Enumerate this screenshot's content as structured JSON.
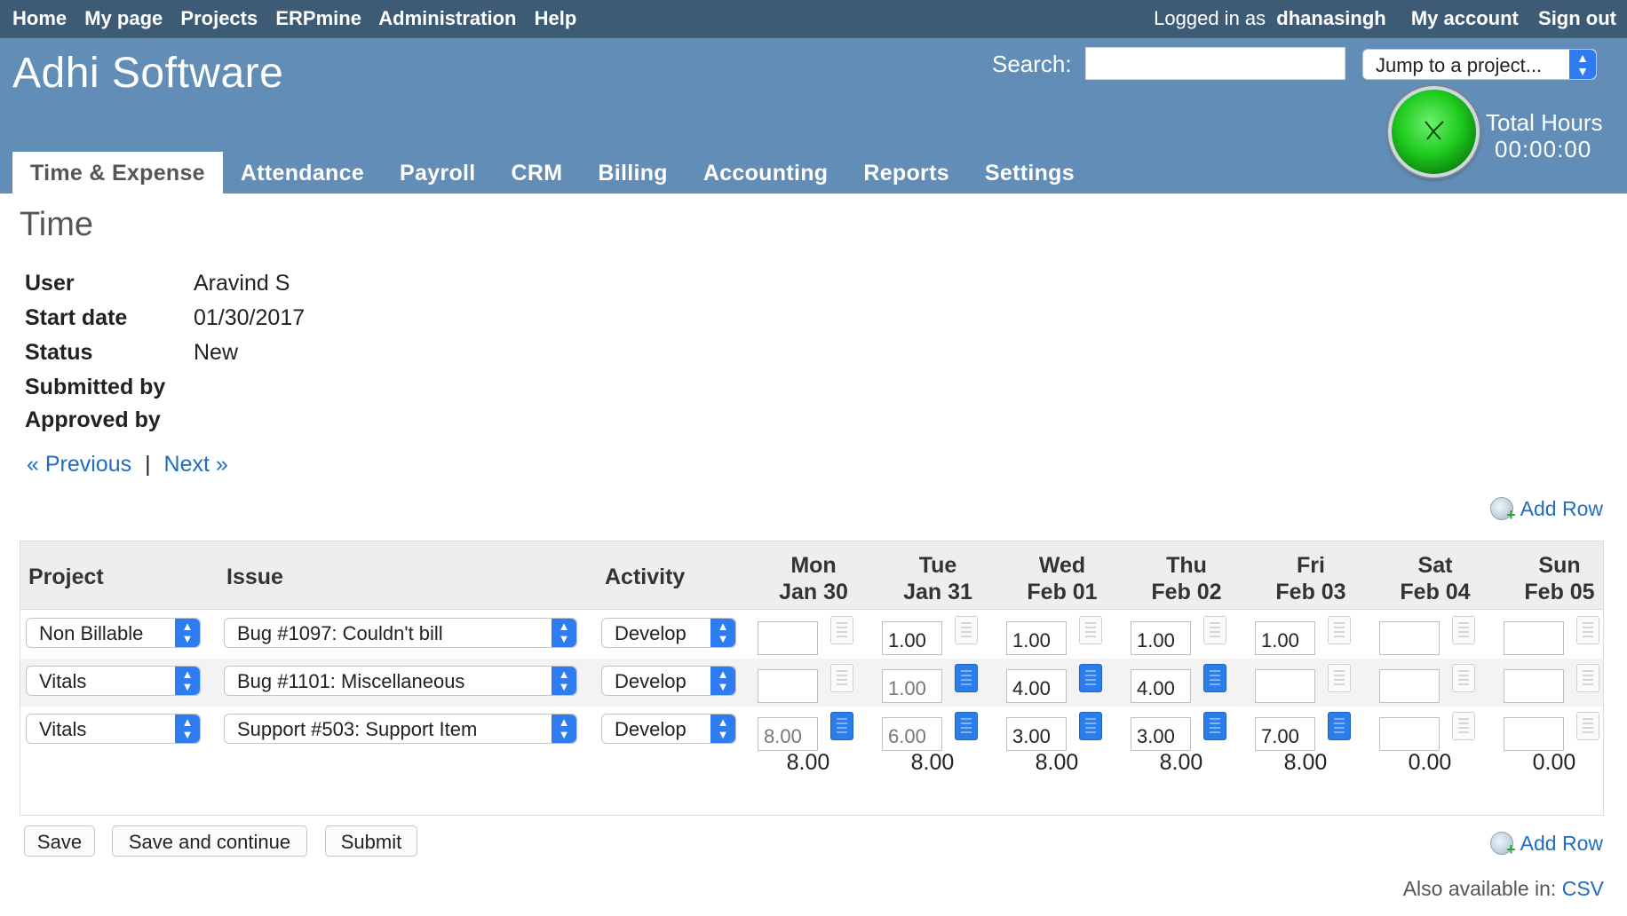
{
  "top_menu": {
    "items": [
      "Home",
      "My page",
      "Projects",
      "ERPmine",
      "Administration",
      "Help"
    ],
    "logged_in_prefix": "Logged in as",
    "user": "dhanasingh",
    "my_account": "My account",
    "sign_out": "Sign out"
  },
  "header": {
    "site_title": "Adhi Software",
    "search_label": "Search:",
    "search_value": "",
    "jump_to_project": "Jump to a project...",
    "total_hours_label": "Total Hours",
    "total_hours_value": "00:00:00"
  },
  "main_menu": [
    "Time & Expense",
    "Attendance",
    "Payroll",
    "CRM",
    "Billing",
    "Accounting",
    "Reports",
    "Settings"
  ],
  "page": {
    "title": "Time",
    "user_label": "User",
    "user_value": "Aravind S",
    "start_date_label": "Start date",
    "start_date_value": "01/30/2017",
    "status_label": "Status",
    "status_value": "New",
    "submitted_by_label": "Submitted by",
    "approved_by_label": "Approved by",
    "previous": "« Previous",
    "separator": "|",
    "next": "Next »",
    "add_row": "Add Row"
  },
  "table": {
    "headers": {
      "project": "Project",
      "issue": "Issue",
      "activity": "Activity"
    },
    "days": [
      {
        "dow": "Mon",
        "date": "Jan 30"
      },
      {
        "dow": "Tue",
        "date": "Jan 31"
      },
      {
        "dow": "Wed",
        "date": "Feb 01"
      },
      {
        "dow": "Thu",
        "date": "Feb 02"
      },
      {
        "dow": "Fri",
        "date": "Feb 03"
      },
      {
        "dow": "Sat",
        "date": "Feb 04"
      },
      {
        "dow": "Sun",
        "date": "Feb 05"
      }
    ],
    "rows": [
      {
        "project": "Non Billable",
        "issue": "Bug #1097: Couldn't bill",
        "activity": "Develop",
        "hours": [
          "",
          "1.00",
          "1.00",
          "1.00",
          "1.00",
          "",
          ""
        ]
      },
      {
        "project": "Vitals",
        "issue": "Bug #1101: Miscellaneous",
        "activity": "Develop",
        "hours": [
          "",
          "1.00",
          "4.00",
          "4.00",
          "",
          "",
          ""
        ]
      },
      {
        "project": "Vitals",
        "issue": "Support #503: Support Item",
        "activity": "Develop",
        "hours": [
          "8.00",
          "6.00",
          "3.00",
          "3.00",
          "7.00",
          "",
          ""
        ]
      }
    ],
    "totals": [
      "8.00",
      "8.00",
      "8.00",
      "8.00",
      "8.00",
      "0.00",
      "0.00"
    ]
  },
  "buttons": {
    "save": "Save",
    "save_continue": "Save and continue",
    "submit": "Submit"
  },
  "footer": {
    "also_available": "Also available in:",
    "csv": "CSV"
  },
  "colors": {
    "top_bar": "#3e5b76",
    "header": "#628db6",
    "link": "#1f6dbf",
    "select_arrow": "#2f7bf0",
    "clock": "#1fcb1f"
  }
}
